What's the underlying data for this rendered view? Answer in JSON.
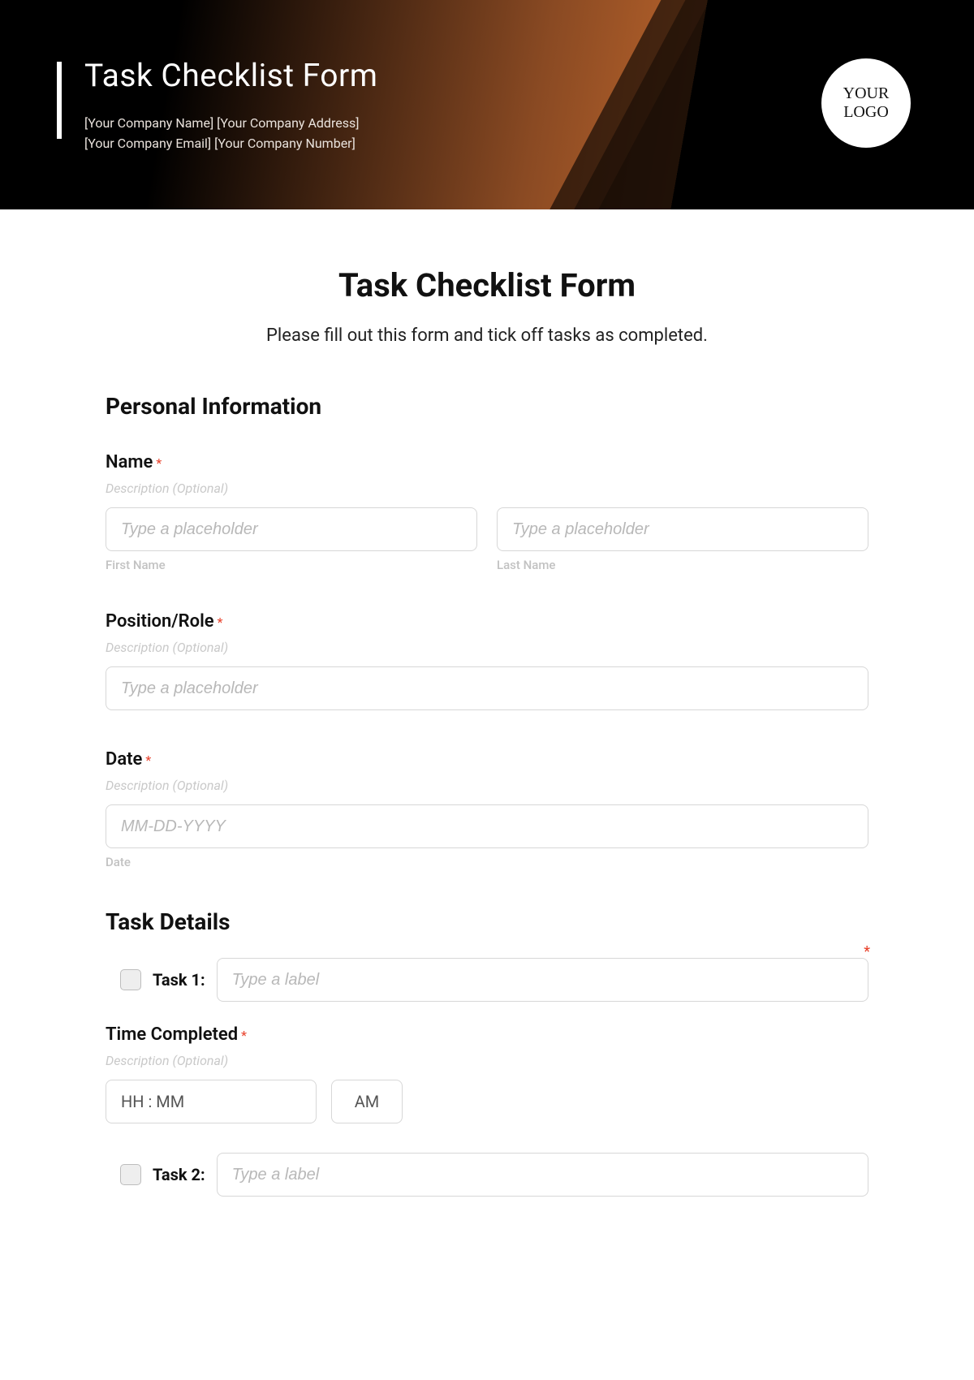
{
  "banner": {
    "title": "Task Checklist Form",
    "line1": "[Your Company Name] [Your Company Address]",
    "line2": "[Your Company Email] [Your Company Number]",
    "logo_text": "YOUR LOGO"
  },
  "form": {
    "title": "Task Checklist Form",
    "intro": "Please fill out this form and tick off tasks as completed."
  },
  "sections": {
    "personal": "Personal Information",
    "tasks": "Task Details"
  },
  "name": {
    "label": "Name",
    "desc": "Description (Optional)",
    "first_placeholder": "Type a placeholder",
    "last_placeholder": "Type a placeholder",
    "first_sub": "First Name",
    "last_sub": "Last Name"
  },
  "position": {
    "label": "Position/Role",
    "desc": "Description (Optional)",
    "placeholder": "Type a placeholder"
  },
  "date": {
    "label": "Date",
    "desc": "Description (Optional)",
    "placeholder": "MM-DD-YYYY",
    "sub": "Date"
  },
  "task1": {
    "prefix": "Task 1:",
    "placeholder": "Type a label"
  },
  "time": {
    "label": "Time Completed",
    "desc": "Description (Optional)",
    "value": "HH : MM",
    "ampm": "AM"
  },
  "task2": {
    "prefix": "Task 2:",
    "placeholder": "Type a label"
  },
  "required_mark": "*"
}
